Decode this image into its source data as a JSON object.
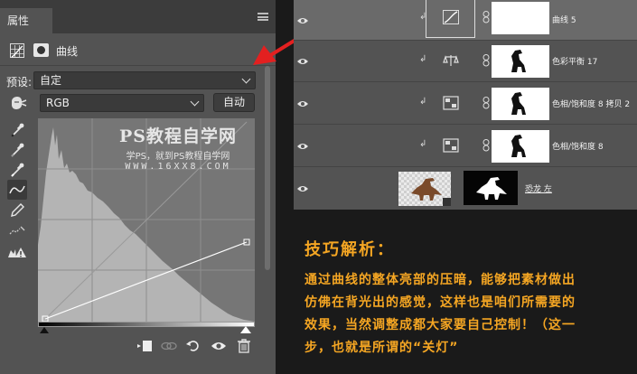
{
  "properties_panel": {
    "tab_label": "属性",
    "adjustment_title": "曲线",
    "preset_label": "预设:",
    "preset_value": "自定",
    "channel_value": "RGB",
    "auto_button_label": "自动",
    "tools": [
      "eyedropper-black-icon",
      "eyedropper-gray-icon",
      "eyedropper-white-icon",
      "curve-point-icon",
      "pencil-icon",
      "smooth-icon",
      "clipping-warning-icon"
    ],
    "footer_buttons": [
      "clip-to-layer-icon",
      "view-previous-icon",
      "reset-icon",
      "visibility-icon",
      "trash-icon"
    ],
    "curve_points": [
      [
        0,
        0
      ],
      [
        255,
        114
      ]
    ],
    "watermark": {
      "line1": "PS教程自学网",
      "line2": "学PS，就到PS教程自学网",
      "line3": "WWW.16XX8.COM"
    }
  },
  "layers_panel": {
    "layers": [
      {
        "name": "曲线 5",
        "icon": "curves-icon",
        "mask": "white",
        "selected": true
      },
      {
        "name": "色彩平衡 17",
        "icon": "color-balance-icon",
        "mask": "dinosaur"
      },
      {
        "name": "色相/饱和度 8 拷贝 2",
        "icon": "hue-saturation-icon",
        "mask": "dinosaur"
      },
      {
        "name": "色相/饱和度 8",
        "icon": "hue-saturation-icon",
        "mask": "dinosaur"
      },
      {
        "name": "恐龙 左",
        "icon": "image-thumb",
        "mask": "dinosaur-black"
      }
    ]
  },
  "tip": {
    "heading": "技巧解析：",
    "body": "通过曲线的整体亮部的压暗，能够把素材做出\n仿佛在背光出的感觉，这样也是咱们所需要的\n效果，当然调整成都大家要自己控制！（这一\n步，也就是所谓的“关灯”"
  },
  "colors": {
    "accent": "#f5a623",
    "annotation_arrow": "#e32020",
    "panel_bg": "#535353"
  }
}
